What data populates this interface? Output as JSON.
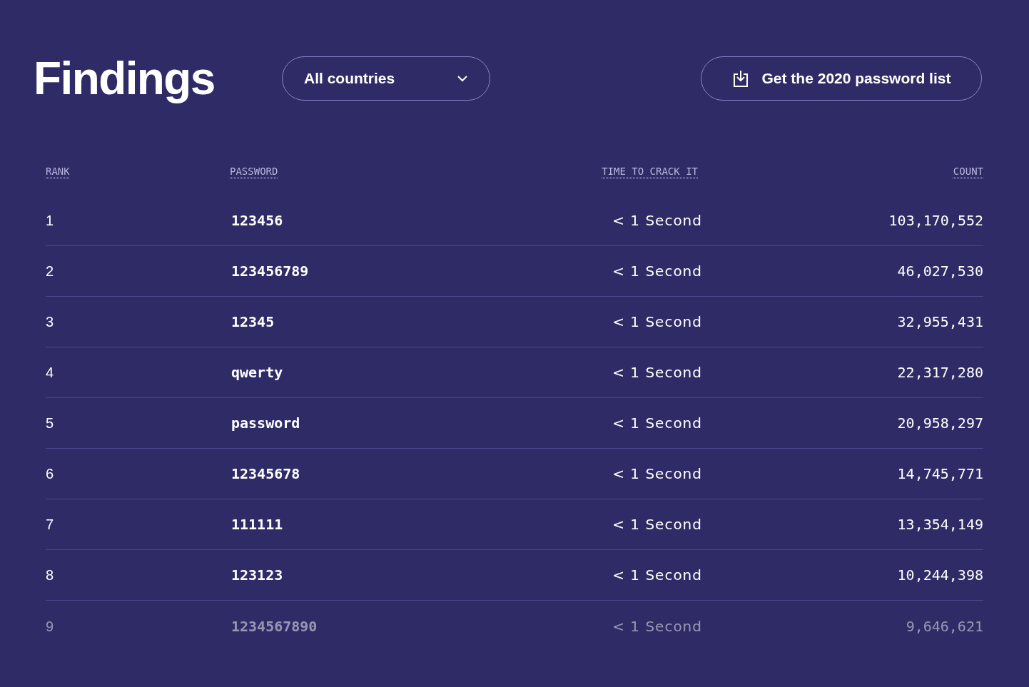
{
  "title": "Findings",
  "country_select": {
    "value": "All countries"
  },
  "download_button": {
    "label": "Get the 2020 password list"
  },
  "table": {
    "columns": [
      "RANK",
      "PASSWORD",
      "TIME TO CRACK IT",
      "COUNT"
    ],
    "rows": [
      {
        "rank": "1",
        "password": "123456",
        "time": "< 1 Second",
        "count": "103,170,552",
        "faded": false
      },
      {
        "rank": "2",
        "password": "123456789",
        "time": "< 1 Second",
        "count": "46,027,530",
        "faded": false
      },
      {
        "rank": "3",
        "password": "12345",
        "time": "< 1 Second",
        "count": "32,955,431",
        "faded": false
      },
      {
        "rank": "4",
        "password": "qwerty",
        "time": "< 1 Second",
        "count": "22,317,280",
        "faded": false
      },
      {
        "rank": "5",
        "password": "password",
        "time": "< 1 Second",
        "count": "20,958,297",
        "faded": false
      },
      {
        "rank": "6",
        "password": "12345678",
        "time": "< 1 Second",
        "count": "14,745,771",
        "faded": false
      },
      {
        "rank": "7",
        "password": "111111",
        "time": "< 1 Second",
        "count": "13,354,149",
        "faded": false
      },
      {
        "rank": "8",
        "password": "123123",
        "time": "< 1 Second",
        "count": "10,244,398",
        "faded": false
      },
      {
        "rank": "9",
        "password": "1234567890",
        "time": "< 1 Second",
        "count": "9,646,621",
        "faded": true
      }
    ]
  }
}
